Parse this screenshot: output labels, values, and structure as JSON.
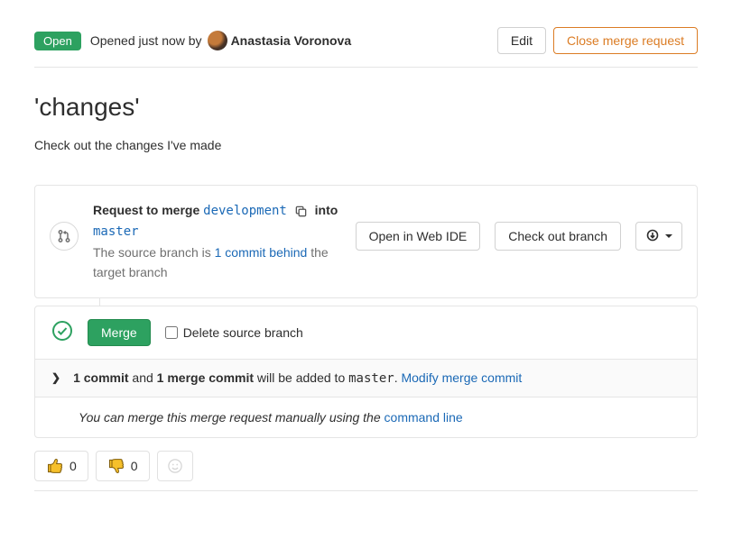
{
  "header": {
    "status": "Open",
    "opened_text": "Opened just now by",
    "author": "Anastasia Voronova",
    "edit_label": "Edit",
    "close_label": "Close merge request"
  },
  "title": "'changes'",
  "description": "Check out the changes I've made",
  "merge_info": {
    "request_prefix": "Request to merge",
    "source_branch": "development",
    "into": "into",
    "target_branch": "master",
    "behind_prefix": "The source branch is",
    "behind_link": "1 commit behind",
    "behind_suffix": "the target branch",
    "open_ide": "Open in Web IDE",
    "checkout": "Check out branch"
  },
  "merge_action": {
    "merge_label": "Merge",
    "delete_branch_label": "Delete source branch"
  },
  "commit_summary": {
    "commit_count": "1 commit",
    "and": " and ",
    "merge_commit": "1 merge commit",
    "added_to": " will be added to ",
    "target": "master",
    "period": ". ",
    "modify_link": "Modify merge commit"
  },
  "manual_merge": {
    "text": "You can merge this merge request manually using the ",
    "link": "command line"
  },
  "reactions": {
    "thumbs_up": 0,
    "thumbs_down": 0
  }
}
